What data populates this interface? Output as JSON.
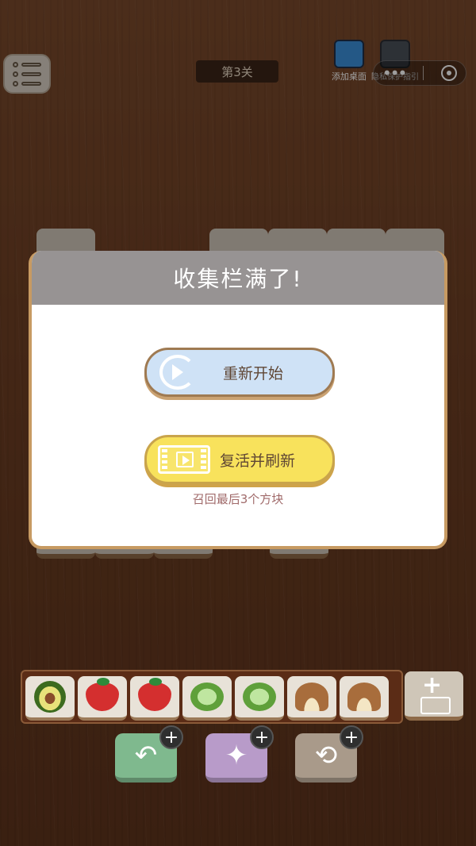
{
  "top": {
    "level_label": "第3关",
    "add_desktop_label": "添加桌面",
    "privacy_label": "隐私保护指引",
    "more_glyph": "•••"
  },
  "dialog": {
    "title": "收集栏满了!",
    "restart_label": "重新开始",
    "revive_label": "复活并刷新",
    "revive_sub": "召回最后3个方块"
  },
  "tray": {
    "slots": [
      "avocado",
      "strawberry",
      "strawberry",
      "lettuce",
      "lettuce",
      "mushroom",
      "mushroom"
    ],
    "extra_slot_plus": "+"
  },
  "tools": {
    "undo_icon": "undo-icon",
    "hint_icon": "lightbulb-icon",
    "shuffle_icon": "shuffle-icon",
    "badge_label": "+"
  },
  "colors": {
    "dialog_header": "#979393",
    "restart_button": "#cfe2f6",
    "revive_button": "#f8e25c"
  }
}
